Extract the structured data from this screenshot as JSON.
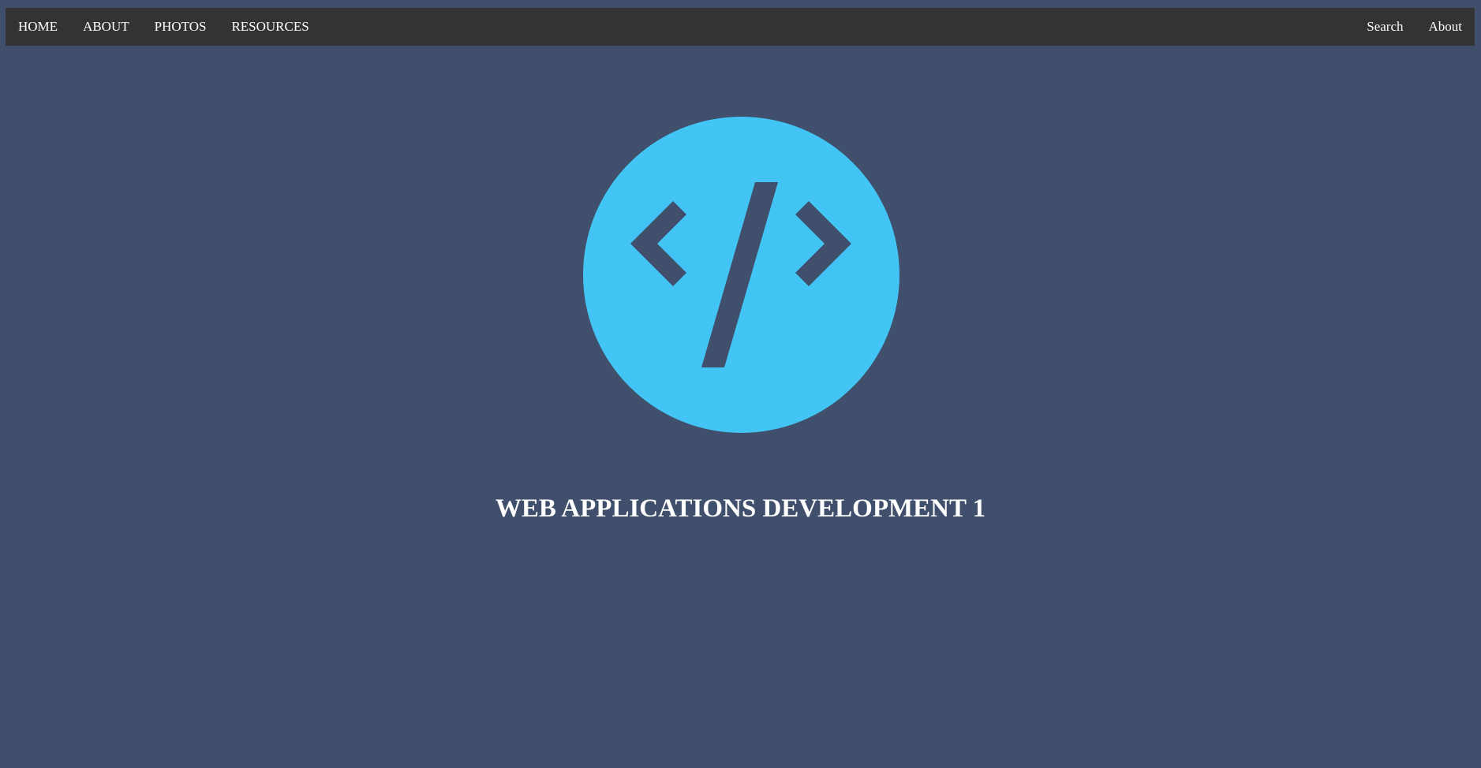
{
  "nav": {
    "left_items": [
      {
        "label": "HOME"
      },
      {
        "label": "ABOUT"
      },
      {
        "label": "PHOTOS"
      },
      {
        "label": "RESOURCES"
      }
    ],
    "right_items": [
      {
        "label": "Search"
      },
      {
        "label": "About"
      }
    ]
  },
  "hero": {
    "logo_icon": "code-icon",
    "logo_color": "#42c5f5",
    "title": "WEB APPLICATIONS DEVELOPMENT 1"
  },
  "colors": {
    "page_background": "#404f6b",
    "navbar_background": "#333333",
    "text": "#ffffff"
  }
}
